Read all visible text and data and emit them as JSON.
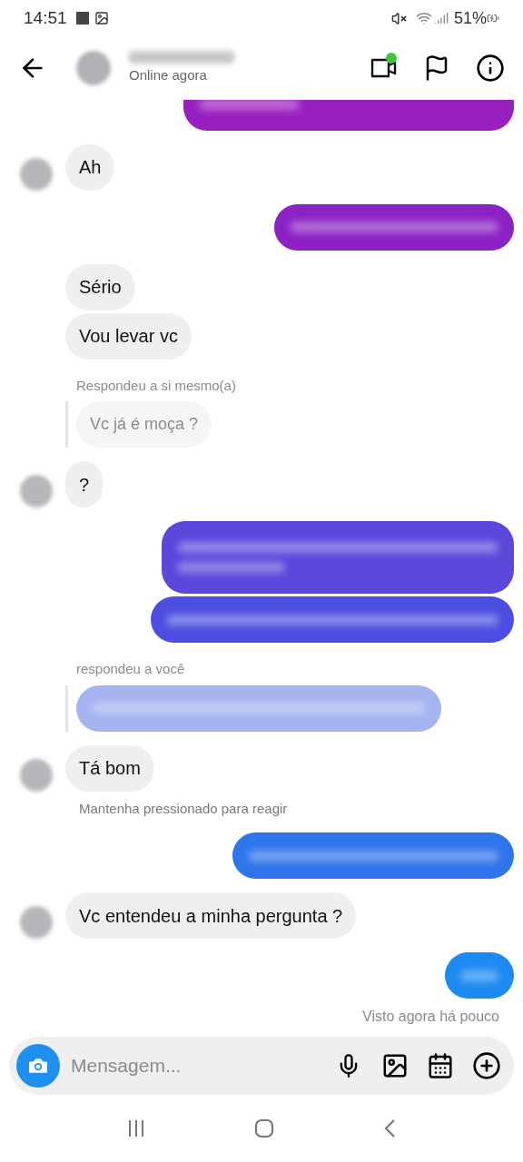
{
  "status_bar": {
    "time": "14:51",
    "battery": "51%"
  },
  "header": {
    "status": "Online agora",
    "video_call_active": true
  },
  "messages": [
    {
      "kind": "sent",
      "color": "#9a1fc0"
    },
    {
      "kind": "received",
      "text": "Ah",
      "avatar": true
    },
    {
      "kind": "sent",
      "color": "#8b22c6"
    },
    {
      "kind": "received",
      "text": "Sério",
      "avatar": false
    },
    {
      "kind": "received",
      "text": "Vou levar vc",
      "avatar": false
    },
    {
      "kind": "reply_label",
      "text": "Respondeu a si mesmo(a)"
    },
    {
      "kind": "quote",
      "text": "Vc já é moça  ?"
    },
    {
      "kind": "received",
      "text": "?",
      "avatar": true
    },
    {
      "kind": "sent",
      "color": "#5a48dc"
    },
    {
      "kind": "sent",
      "color": "#4b4ee0"
    },
    {
      "kind": "reply_label",
      "text": "respondeu a você"
    },
    {
      "kind": "quote_blurred",
      "color": "#a6b3f1"
    },
    {
      "kind": "received",
      "text": "Tá bom",
      "avatar": true
    },
    {
      "kind": "hint",
      "text": "Mantenha pressionado para reagir"
    },
    {
      "kind": "sent",
      "color": "#2e74ec"
    },
    {
      "kind": "received",
      "text": "Vc entendeu a minha pergunta  ?",
      "avatar": true
    },
    {
      "kind": "sent",
      "color": "#1d8af1"
    },
    {
      "kind": "seen",
      "text": "Visto agora há pouco"
    }
  ],
  "composer": {
    "placeholder": "Mensagem..."
  }
}
